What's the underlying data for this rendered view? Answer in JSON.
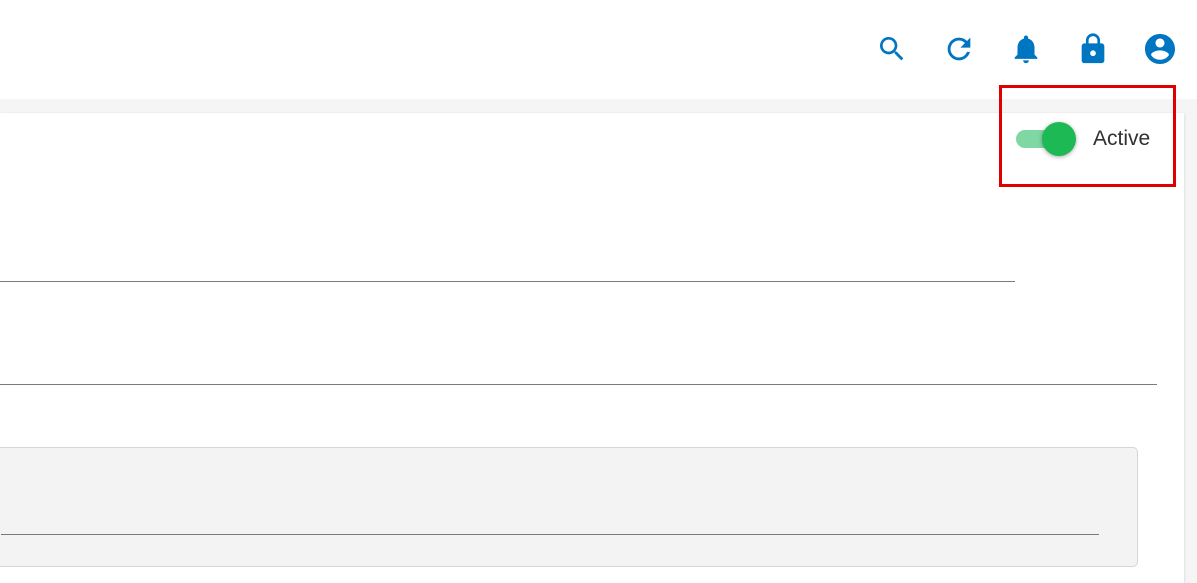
{
  "toolbar": {
    "icons": [
      "search-icon",
      "refresh-icon",
      "bell-icon",
      "lock-icon",
      "account-circle-icon"
    ]
  },
  "status_toggle": {
    "label": "Active",
    "checked": true
  },
  "colors": {
    "icon_blue": "#0075c2",
    "toggle_on": "#1db954",
    "toggle_track": "#7fd7a4",
    "highlight": "#e00000"
  }
}
